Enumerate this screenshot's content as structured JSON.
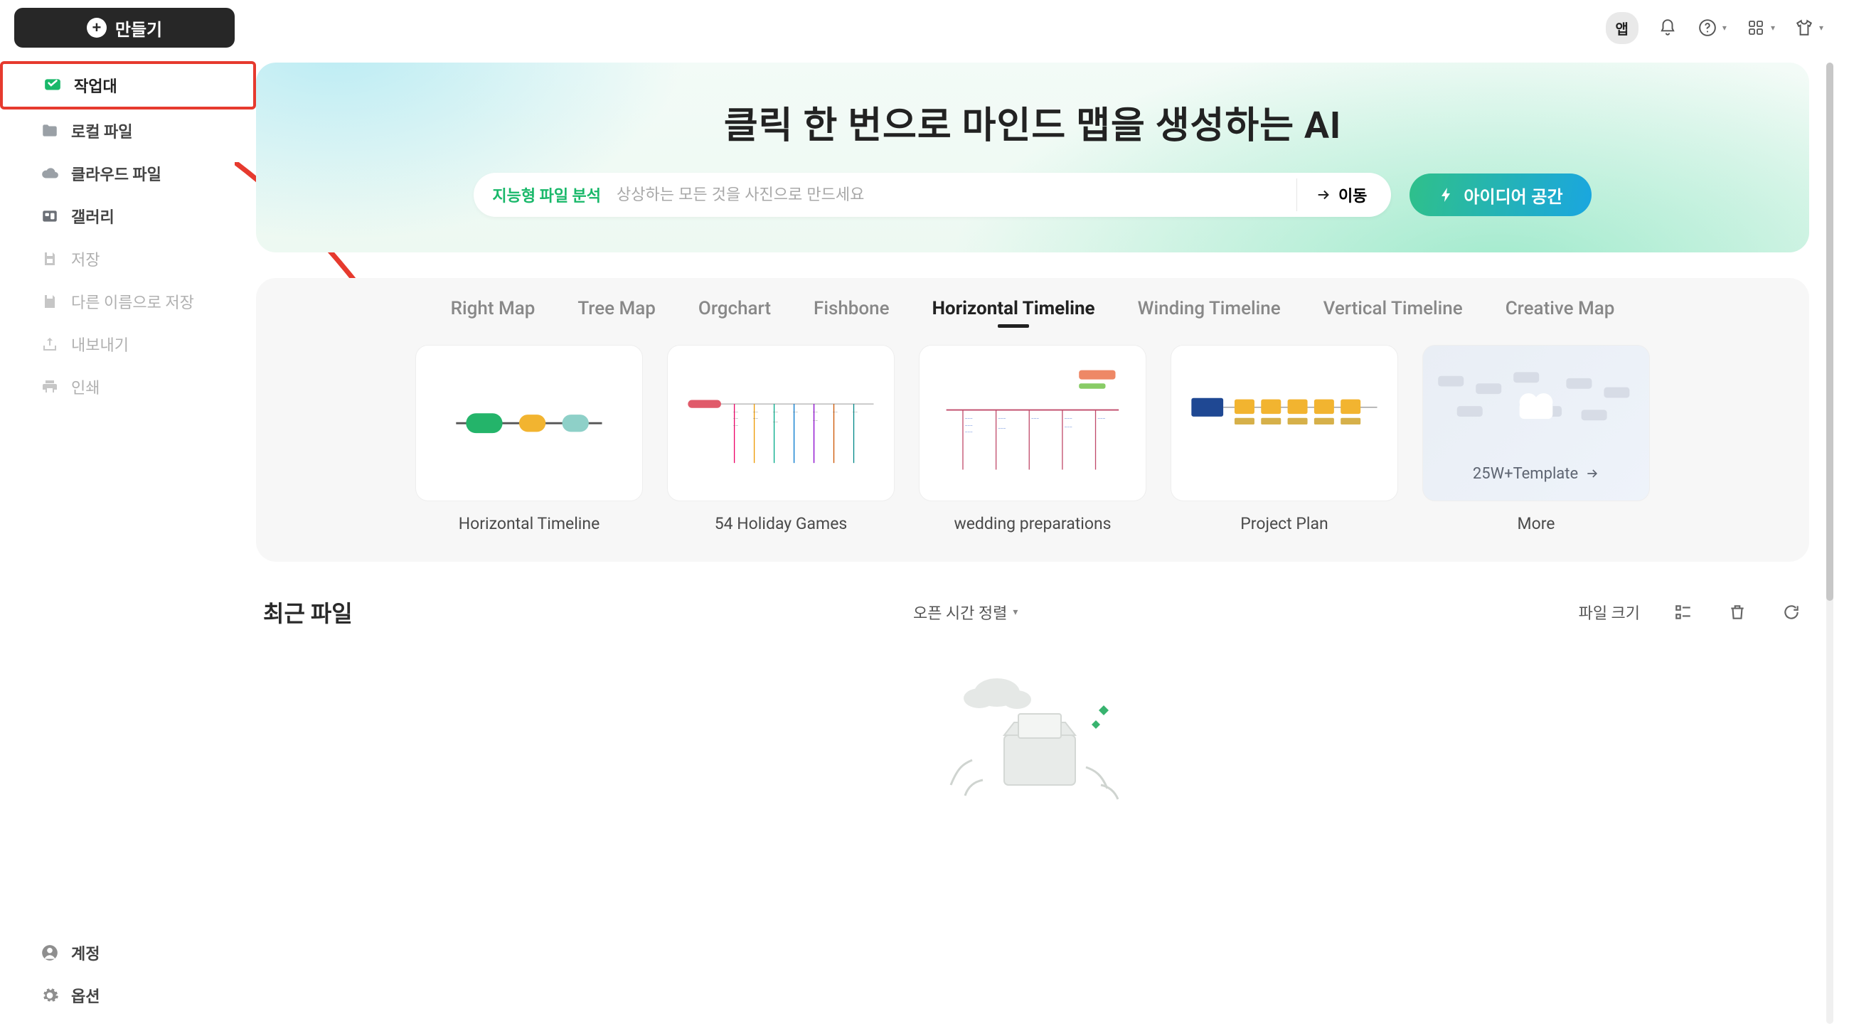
{
  "header": {
    "create_label": "만들기",
    "app_pill": "앱"
  },
  "sidebar": {
    "items": [
      {
        "label": "작업대"
      },
      {
        "label": "로컬 파일"
      },
      {
        "label": "클라우드 파일"
      },
      {
        "label": "갤러리"
      },
      {
        "label": "저장"
      },
      {
        "label": "다른 이름으로 저장"
      },
      {
        "label": "내보내기"
      },
      {
        "label": "인쇄"
      }
    ],
    "bottom": [
      {
        "label": "계정"
      },
      {
        "label": "옵션"
      }
    ]
  },
  "hero": {
    "title": "클릭 한 번으로 마인드 맵을 생성하는 AI",
    "chip": "지능형 파일 분석",
    "placeholder": "상상하는 모든 것을 사진으로 만드세요",
    "go_label": "이동",
    "idea_label": "아이디어 공간"
  },
  "templates": {
    "tabs": [
      "Right Map",
      "Tree Map",
      "Orgchart",
      "Fishbone",
      "Horizontal Timeline",
      "Winding Timeline",
      "Vertical Timeline",
      "Creative Map"
    ],
    "active_tab_index": 4,
    "cards": [
      "Horizontal Timeline",
      "54 Holiday Games",
      "wedding preparations",
      "Project Plan",
      "More"
    ],
    "more_text": "25W+Template"
  },
  "recent": {
    "title": "최근 파일",
    "sort_label": "오픈 시간 정렬",
    "size_label": "파일 크기"
  }
}
